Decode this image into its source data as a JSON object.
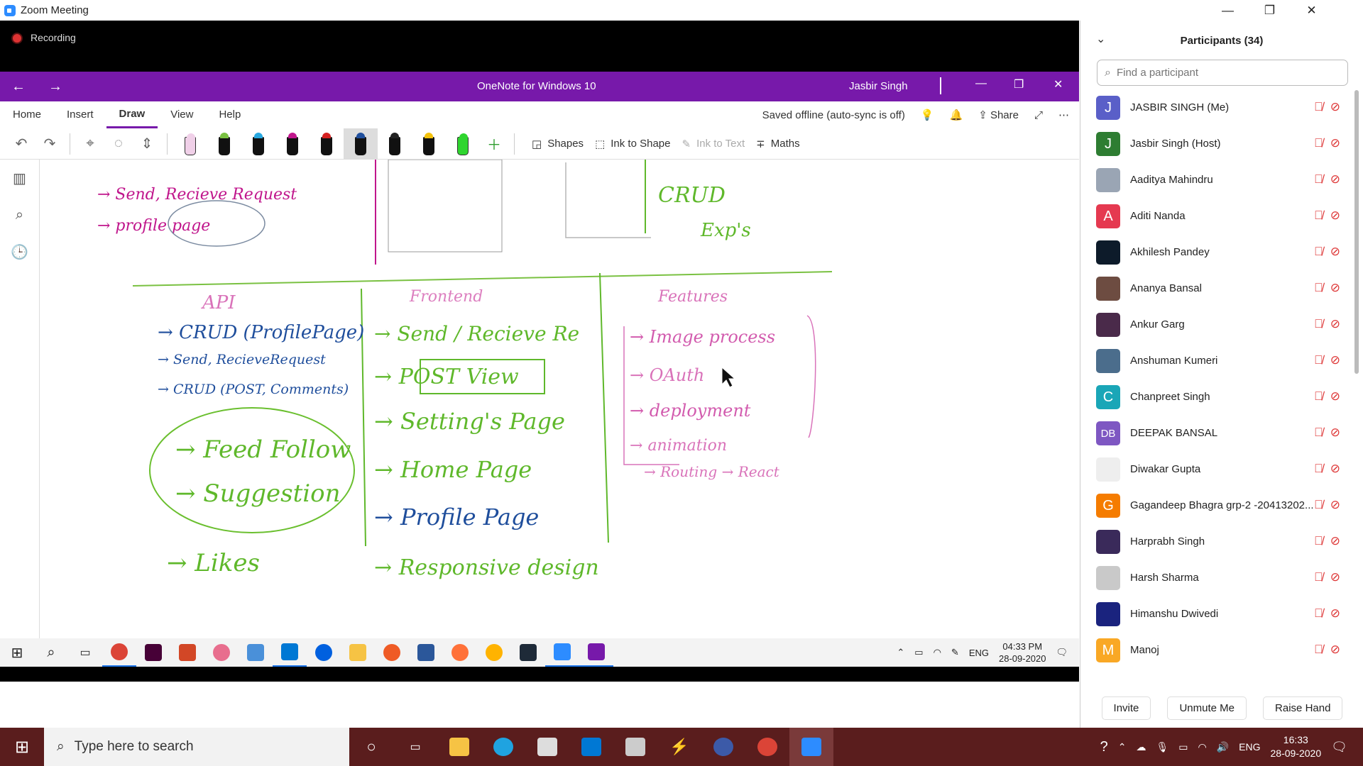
{
  "zoom": {
    "title": "Zoom Meeting",
    "recording_label": "Recording"
  },
  "onenote": {
    "title": "OneNote for Windows 10",
    "user": "Jasbir Singh",
    "tabs": [
      "Home",
      "Insert",
      "Draw",
      "View",
      "Help"
    ],
    "active_tab": "Draw",
    "status": "Saved offline (auto-sync is off)",
    "share_label": "Share",
    "toolbar": {
      "shapes": "Shapes",
      "ink_to_shape": "Ink to Shape",
      "ink_to_text": "Ink to Text",
      "maths": "Maths"
    },
    "pens": [
      {
        "color": "#f0d0e8",
        "kind": "highlighter"
      },
      {
        "color": "#7ac142",
        "kind": "pen"
      },
      {
        "color": "#29a8e0",
        "kind": "pen"
      },
      {
        "color": "#c0168c",
        "kind": "pen"
      },
      {
        "color": "#d42020",
        "kind": "pen"
      },
      {
        "color": "#1f4e9c",
        "kind": "pen",
        "selected": true
      },
      {
        "color": "#222222",
        "kind": "pen"
      },
      {
        "color": "#f4c20d",
        "kind": "pen"
      },
      {
        "color": "#2fd52f",
        "kind": "highlighter"
      }
    ],
    "ink": {
      "top_left": [
        "→ Send, Recieve Request",
        "→ profile page"
      ],
      "api_heading": "API",
      "api_items": [
        "CRUD (ProfilePage)",
        "Send, RecieveRequest",
        "CRUD (POST, Comments)"
      ],
      "circled": [
        "Feed Follow",
        "Suggestion"
      ],
      "likes": "Likes",
      "frontend_heading": "Frontend",
      "frontend_items": [
        "Send / Recieve Re",
        "POST View",
        "Setting's Page",
        "Home Page",
        "Profile Page",
        "Responsive design"
      ],
      "features_heading": "Features",
      "features_items": [
        "Image process",
        "OAuth",
        "deployment",
        "animation",
        "Routing → React"
      ],
      "crud_box": "CRUD",
      "extras": [
        "Exp's"
      ]
    },
    "taskbar_clock": {
      "time": "04:33 PM",
      "date": "28-09-2020"
    },
    "taskbar_lang": "ENG"
  },
  "participants": {
    "header": "Participants (34)",
    "search_placeholder": "Find a participant",
    "list": [
      {
        "name": "JASBIR SINGH (Me)",
        "initials": "J",
        "color": "#5a5fc8"
      },
      {
        "name": "Jasbir Singh (Host)",
        "initials": "J",
        "color": "#2e7d32"
      },
      {
        "name": "Aaditya Mahindru",
        "initials": "",
        "color": "#9aa5b4"
      },
      {
        "name": "Aditi Nanda",
        "initials": "A",
        "color": "#e53950"
      },
      {
        "name": "Akhilesh Pandey",
        "initials": "",
        "color": "#0d1b2a"
      },
      {
        "name": "Ananya Bansal",
        "initials": "",
        "color": "#6d4c41"
      },
      {
        "name": "Ankur Garg",
        "initials": "",
        "color": "#4a2a4a"
      },
      {
        "name": "Anshuman Kumeri",
        "initials": "",
        "color": "#4b6d8c"
      },
      {
        "name": "Chanpreet Singh",
        "initials": "C",
        "color": "#1aa6b7"
      },
      {
        "name": "DEEPAK BANSAL",
        "initials": "DB",
        "color": "#7e57c2"
      },
      {
        "name": "Diwakar Gupta",
        "initials": "",
        "color": "#eeeeee"
      },
      {
        "name": "Gagandeep Bhagra grp-2 -20413202...",
        "initials": "G",
        "color": "#f57c00"
      },
      {
        "name": "Harprabh Singh",
        "initials": "",
        "color": "#3a2a5a"
      },
      {
        "name": "Harsh Sharma",
        "initials": "",
        "color": "#c9c9c9"
      },
      {
        "name": "Himanshu Dwivedi",
        "initials": "",
        "color": "#1a237e"
      },
      {
        "name": "Manoj",
        "initials": "M",
        "color": "#f9a825"
      }
    ],
    "buttons": {
      "invite": "Invite",
      "unmute": "Unmute Me",
      "raise": "Raise Hand"
    }
  },
  "windows": {
    "search_placeholder": "Type here to search",
    "clock": {
      "time": "16:33",
      "date": "28-09-2020"
    },
    "lang": "ENG"
  }
}
